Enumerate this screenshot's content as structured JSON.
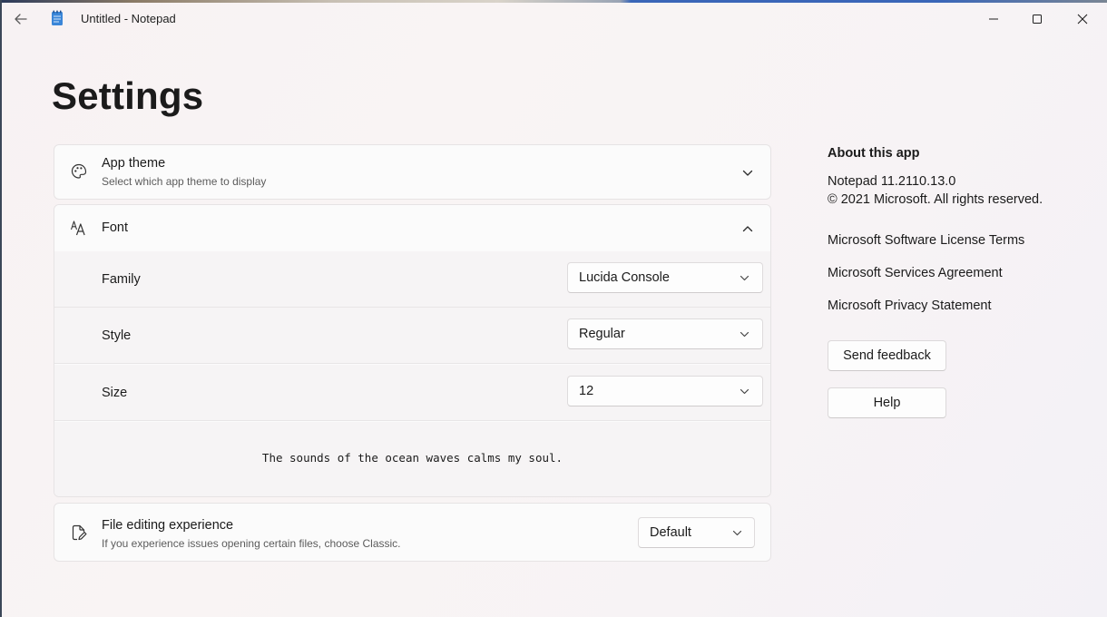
{
  "window": {
    "title": "Untitled - Notepad"
  },
  "page": {
    "title": "Settings"
  },
  "app_theme": {
    "title": "App theme",
    "subtitle": "Select which app theme to display",
    "expanded": false
  },
  "font": {
    "title": "Font",
    "expanded": true,
    "rows": [
      {
        "label": "Family",
        "value": "Lucida Console"
      },
      {
        "label": "Style",
        "value": "Regular"
      },
      {
        "label": "Size",
        "value": "12"
      }
    ],
    "preview_text": "The sounds of the ocean waves calms my soul."
  },
  "file_editing": {
    "title": "File editing experience",
    "subtitle": "If you experience issues opening certain files, choose Classic.",
    "value": "Default"
  },
  "about": {
    "title": "About this app",
    "version": "Notepad 11.2110.13.0",
    "copyright": "© 2021 Microsoft. All rights reserved.",
    "links": [
      "Microsoft Software License Terms",
      "Microsoft Services Agreement",
      "Microsoft Privacy Statement"
    ],
    "feedback_button": "Send feedback",
    "help_button": "Help"
  },
  "icons": {
    "back": "back-arrow-icon",
    "app": "notepad-icon",
    "minimize": "minimize-icon",
    "maximize": "maximize-icon",
    "close": "close-icon",
    "theme": "palette-icon",
    "font": "font-icon",
    "file": "file-edit-icon"
  },
  "colors": {
    "notepad_icon_blue": "#3a86d8"
  }
}
